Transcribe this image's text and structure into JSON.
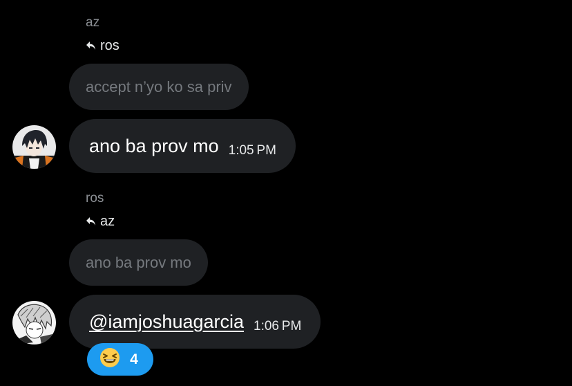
{
  "thread": {
    "message1": {
      "sender": "az",
      "reply_to": "ros",
      "quoted_text": "accept n’yo ko sa priv",
      "text": "ano ba prov mo",
      "time": "1:05 PM",
      "avatar_icon": "anime-boy-dark-hair-avatar"
    },
    "message2": {
      "sender": "ros",
      "reply_to": "az",
      "quoted_text": "ano ba prov mo",
      "text": "@iamjoshuagarcia",
      "time": "1:06 PM",
      "avatar_icon": "anime-manga-sketch-avatar",
      "reaction": {
        "emoji": "😆",
        "icon": "laughing-face-emoji",
        "count": "4"
      }
    }
  },
  "colors": {
    "background": "#000000",
    "bubble": "#1f2124",
    "muted_text": "#8b8f94",
    "reaction_accent": "#1d9bf0"
  }
}
